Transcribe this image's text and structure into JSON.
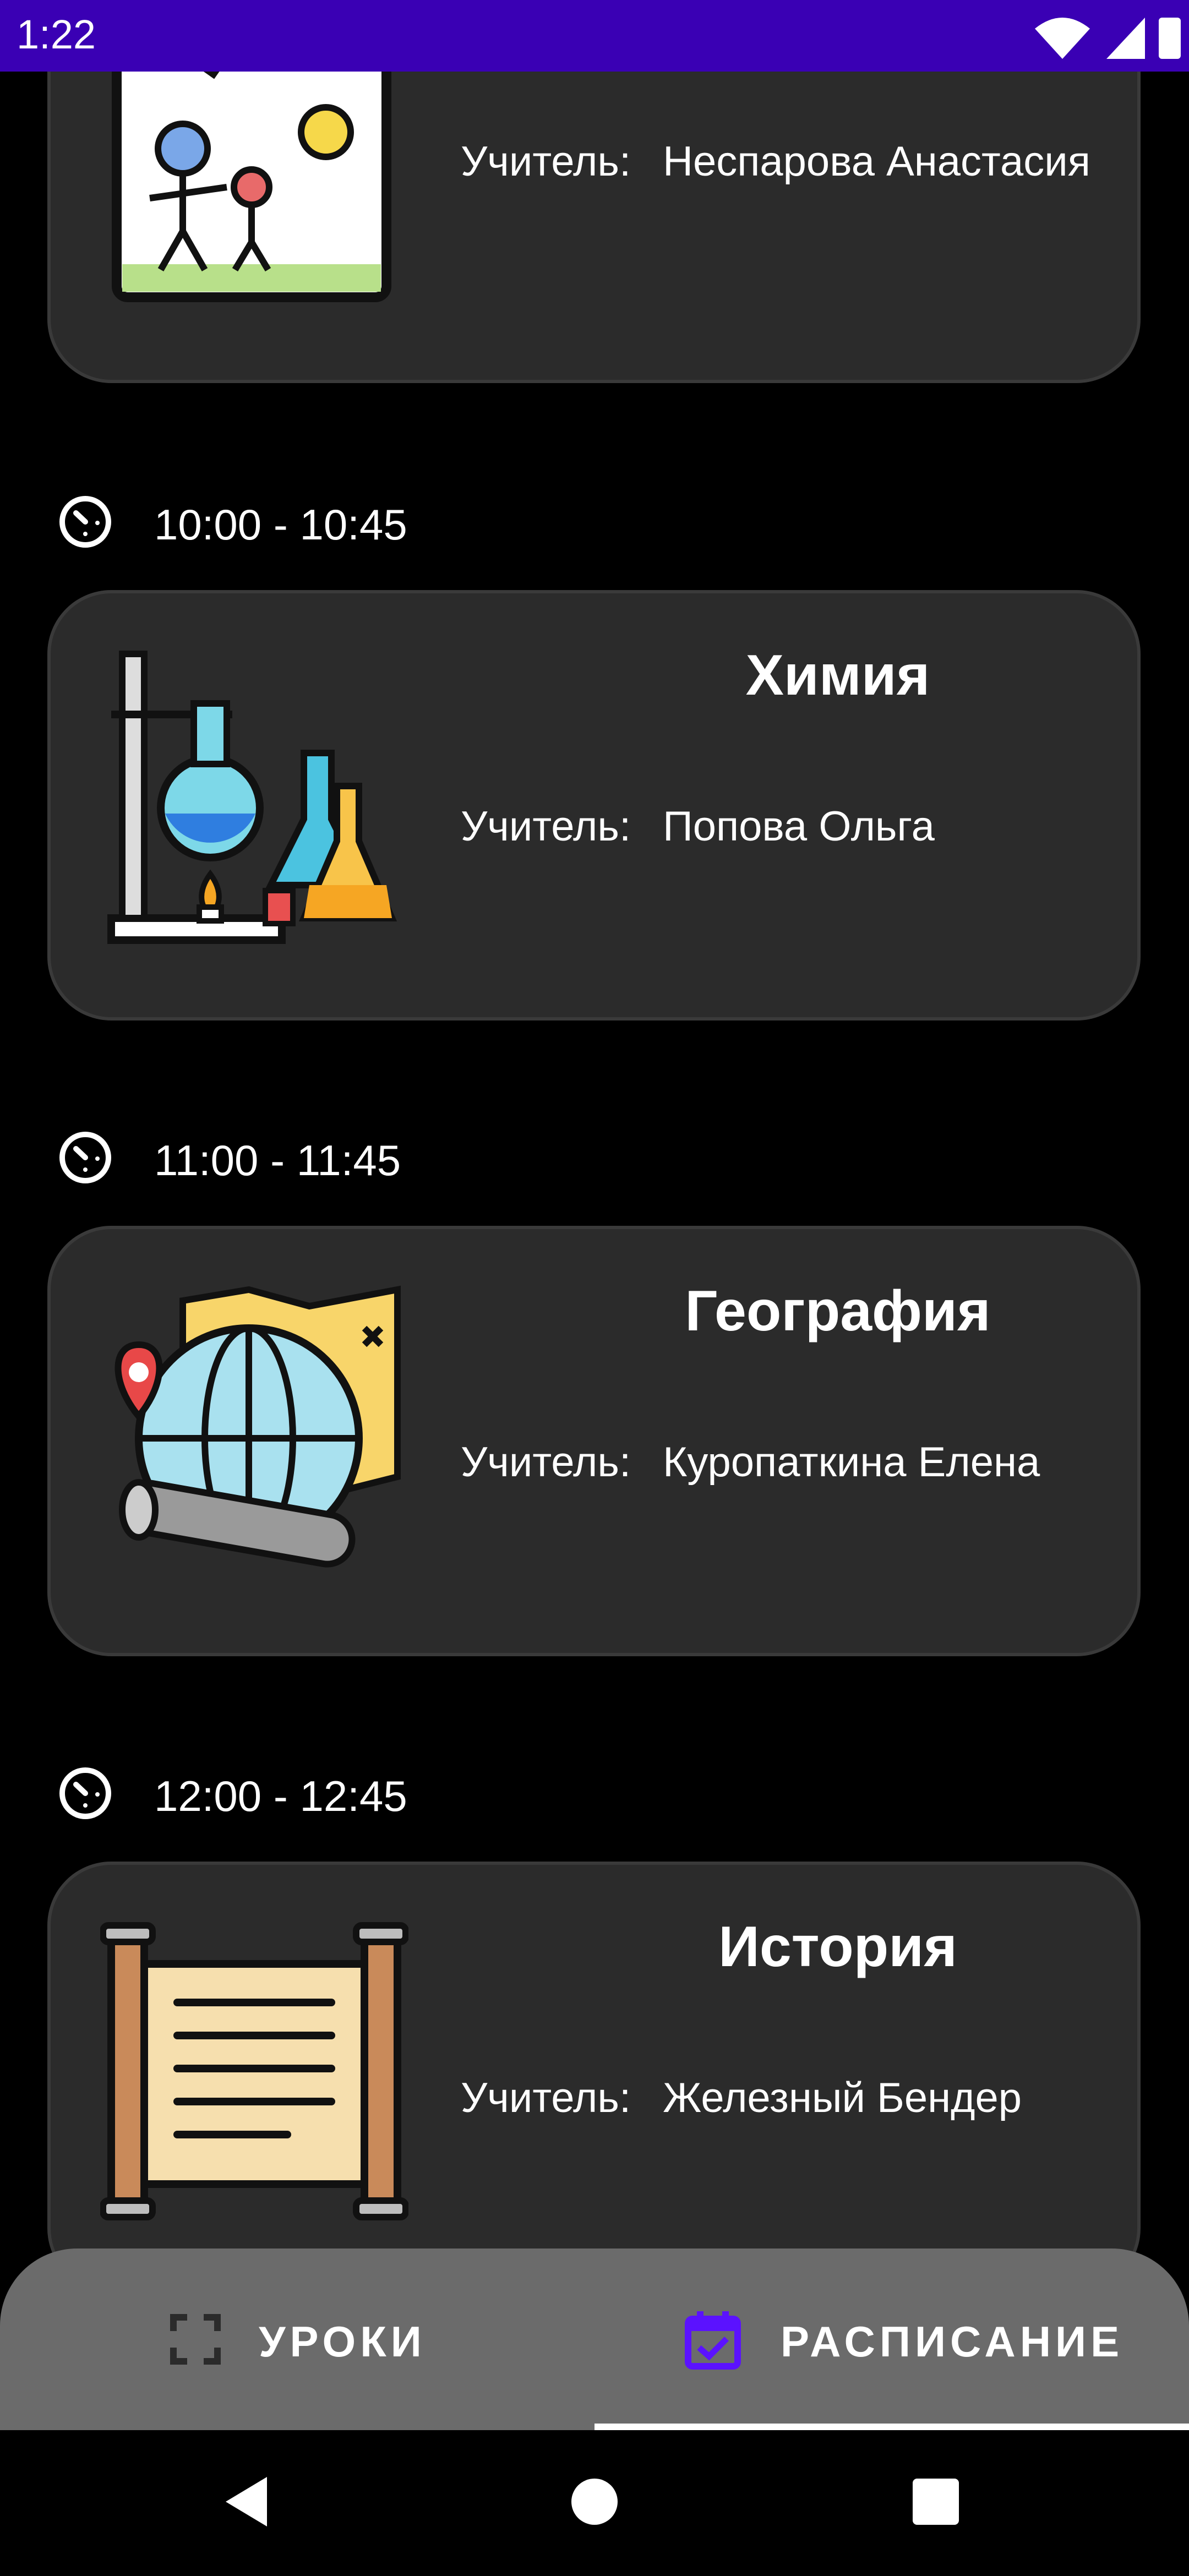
{
  "status_bar": {
    "time": "1:22"
  },
  "schedule": [
    {
      "time": "",
      "subject": "",
      "teacher_label": "Учитель:",
      "teacher": "Неспарова Анастасия",
      "image": "drawing-icon"
    },
    {
      "time": "10:00 - 10:45",
      "subject": "Химия",
      "teacher_label": "Учитель:",
      "teacher": "Попова Ольга",
      "image": "chemistry-icon"
    },
    {
      "time": "11:00 - 11:45",
      "subject": "География",
      "teacher_label": "Учитель:",
      "teacher": "Куропаткина Елена",
      "image": "geography-icon"
    },
    {
      "time": "12:00 - 12:45",
      "subject": "История",
      "teacher_label": "Учитель:",
      "teacher": "Железный Бендер",
      "image": "history-scroll-icon"
    }
  ],
  "bottom_nav": {
    "items": [
      {
        "label": "УРОКИ",
        "icon": "fullscreen-icon",
        "active": false
      },
      {
        "label": "РАСПИСАНИЕ",
        "icon": "calendar-check-icon",
        "active": true
      }
    ]
  },
  "colors": {
    "status_bar": "#3a00b4",
    "card": "#2b2b2b",
    "nav": "#6b6b6b",
    "accent": "#5b12ff"
  }
}
